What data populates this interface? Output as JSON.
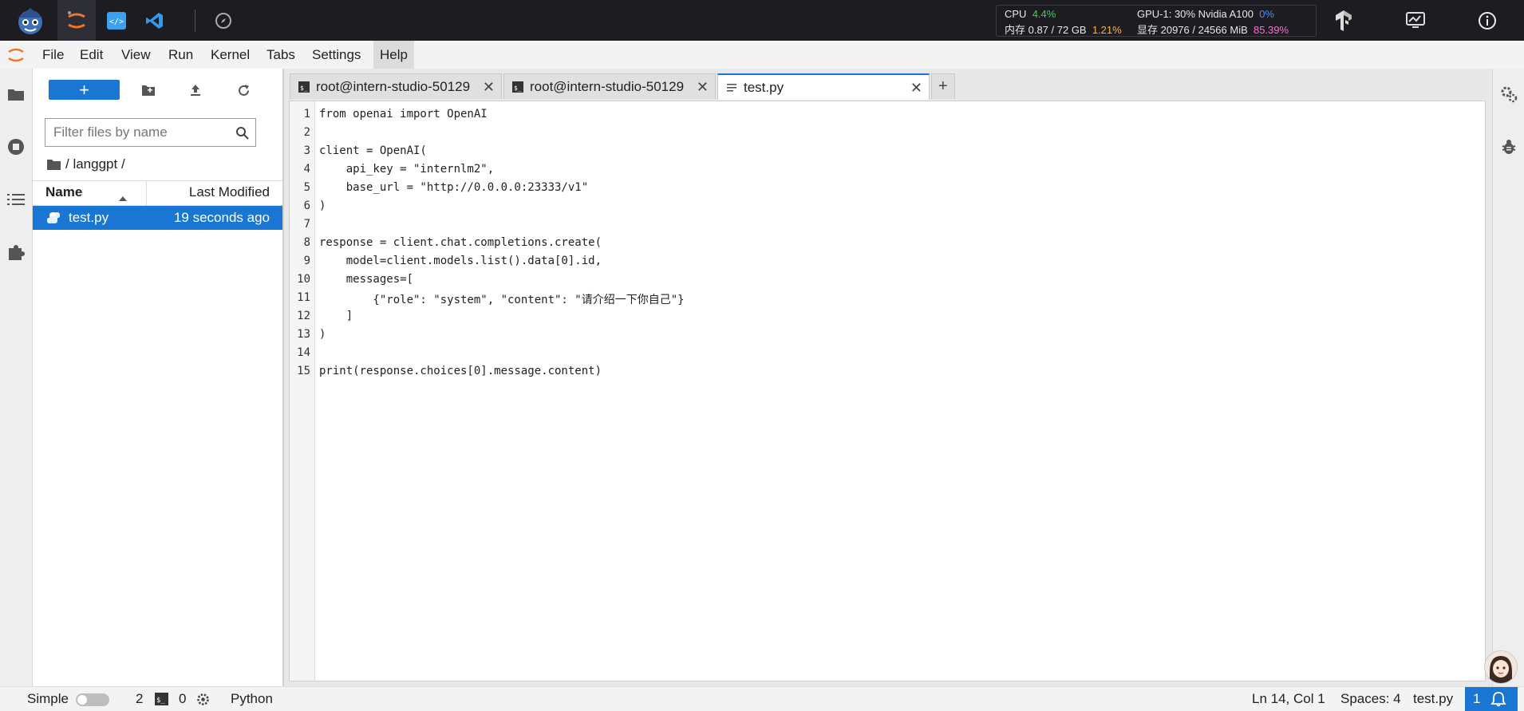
{
  "top_bar": {
    "apps": [
      "studio-logo-icon",
      "jupyter-icon",
      "code-server-icon",
      "vscode-icon",
      "compass-icon"
    ],
    "metrics": {
      "cpu_label": "CPU",
      "cpu_value": "4.4%",
      "mem_label": "内存 0.87 / 72 GB",
      "mem_value": "1.21%",
      "gpu_label": "GPU-1: 30% Nvidia A100",
      "gpu_value": "0%",
      "vram_label": "显存 20976 / 24566 MiB",
      "vram_value": "85.39%"
    },
    "right_icons": [
      "tensorflow-icon",
      "monitor-icon",
      "info-icon"
    ]
  },
  "menu": {
    "items": [
      "File",
      "Edit",
      "View",
      "Run",
      "Kernel",
      "Tabs",
      "Settings",
      "Help"
    ],
    "active": "Help"
  },
  "file_browser": {
    "new_label": "+",
    "filter_placeholder": "Filter files by name",
    "breadcrumb": "/ langgpt /",
    "columns": {
      "name": "Name",
      "modified": "Last Modified"
    },
    "files": [
      {
        "name": "test.py",
        "modified": "19 seconds ago",
        "selected": true
      }
    ]
  },
  "tabs": [
    {
      "label": "root@intern-studio-50129",
      "kind": "terminal"
    },
    {
      "label": "root@intern-studio-50129",
      "kind": "terminal"
    },
    {
      "label": "test.py",
      "kind": "file",
      "active": true
    }
  ],
  "editor": {
    "line_numbers": [
      "1",
      "2",
      "3",
      "4",
      "5",
      "6",
      "7",
      "8",
      "9",
      "10",
      "11",
      "12",
      "13",
      "14",
      "15"
    ],
    "lines": [
      "from openai import OpenAI",
      "",
      "client = OpenAI(",
      "    api_key = \"internlm2\",",
      "    base_url = \"http://0.0.0.0:23333/v1\"",
      ")",
      "",
      "response = client.chat.completions.create(",
      "    model=client.models.list().data[0].id,",
      "    messages=[",
      "        {\"role\": \"system\", \"content\": \"请介绍一下你自己\"}",
      "    ]",
      ")",
      "",
      "print(response.choices[0].message.content)"
    ]
  },
  "status_bar": {
    "mode_label": "Simple",
    "mode_enabled": false,
    "kernels_count": "2",
    "terminals_count": "0",
    "language": "Python",
    "cursor": "Ln 14, Col 1",
    "spaces": "Spaces: 4",
    "filename": "test.py",
    "notifications": "1"
  },
  "colors": {
    "accent": "#1976d2",
    "topbar": "#1c1c21"
  }
}
